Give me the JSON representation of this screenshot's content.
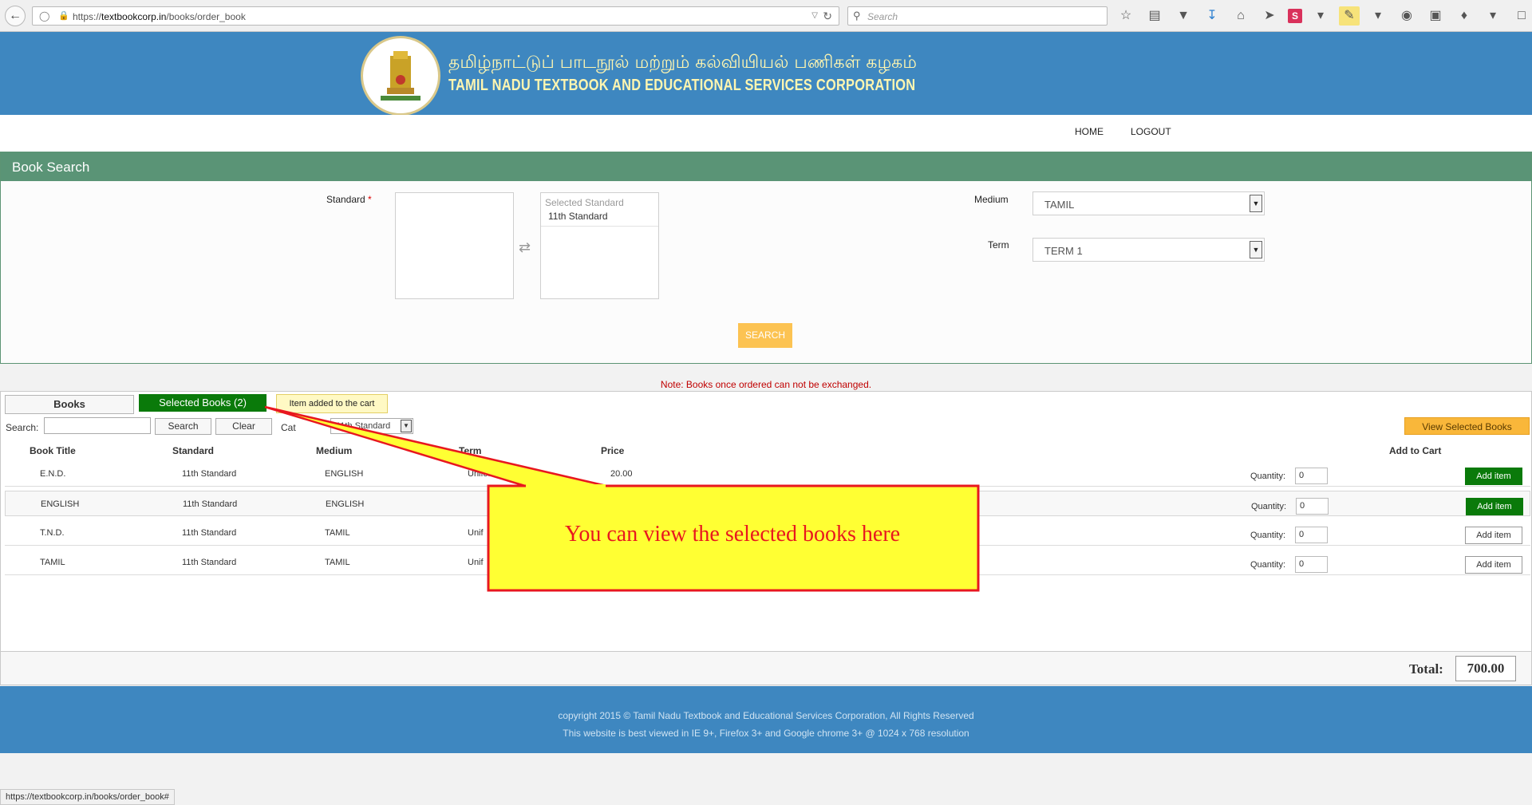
{
  "browser": {
    "url_prefix": "https://",
    "url_host": "textbookcorp.in",
    "url_path": "/books/order_book",
    "search_placeholder": "Search",
    "status_url": "https://textbookcorp.in/books/order_book#"
  },
  "header": {
    "title_tamil": "தமிழ்நாட்டுப் பாடநூல் மற்றும் கல்வியியல் பணிகள் கழகம்",
    "title_english": "TAMIL NADU TEXTBOOK AND EDUCATIONAL SERVICES CORPORATION"
  },
  "menu": {
    "home": "HOME",
    "logout": "LOGOUT"
  },
  "book_search": {
    "title": "Book Search",
    "standard_label": "Standard",
    "required_mark": "*",
    "selected_standard_header": "Selected Standard",
    "selected_standard_item": "11th Standard",
    "medium_label": "Medium",
    "medium_value": "TAMIL",
    "term_label": "Term",
    "term_value": "TERM 1",
    "search_button": "SEARCH"
  },
  "note": "Note: Books once ordered can not be exchanged.",
  "tabs": {
    "books": "Books",
    "selected_books": "Selected Books (2)",
    "tooltip": "Item added to the cart"
  },
  "toolbar": {
    "search_label": "Search:",
    "search_button": "Search",
    "clear_button": "Clear",
    "filter_label": "Cat",
    "filter_value": "11th Standard",
    "view_selected_button": "View Selected Books"
  },
  "table": {
    "headers": [
      "Book Title",
      "Standard",
      "Medium",
      "Term",
      "Price",
      "Add to Cart"
    ],
    "qty_label": "Quantity:",
    "add_label": "Add item",
    "rows": [
      {
        "title": "E.N.D.",
        "standard": "11th Standard",
        "medium": "ENGLISH",
        "term": "Uniform",
        "price": "20.00",
        "qty": "0",
        "added": true
      },
      {
        "title": "ENGLISH",
        "standard": "11th Standard",
        "medium": "ENGLISH",
        "term": "",
        "price": "",
        "qty": "0",
        "added": true
      },
      {
        "title": "T.N.D.",
        "standard": "11th Standard",
        "medium": "TAMIL",
        "term": "Unif",
        "price": "",
        "qty": "0",
        "added": false
      },
      {
        "title": "TAMIL",
        "standard": "11th Standard",
        "medium": "TAMIL",
        "term": "Unif",
        "price": "",
        "qty": "0",
        "added": false
      }
    ]
  },
  "total": {
    "label": "Total:",
    "value": "700.00"
  },
  "footer": {
    "copyright": "copyright 2015 © Tamil Nadu Textbook and Educational Services Corporation, All Rights Reserved",
    "browser_note": "This website is best viewed in IE 9+, Firefox 3+ and Google chrome 3+ @ 1024 x 768 resolution"
  },
  "callout": {
    "text": "You can view the selected books here"
  },
  "colors": {
    "header_blue": "#3e87c0",
    "panel_green": "#5a9476",
    "tab_green": "#0a7a0a",
    "search_orange": "#fcc352",
    "callout_yellow": "#ffff33",
    "callout_red": "#e8171f"
  }
}
